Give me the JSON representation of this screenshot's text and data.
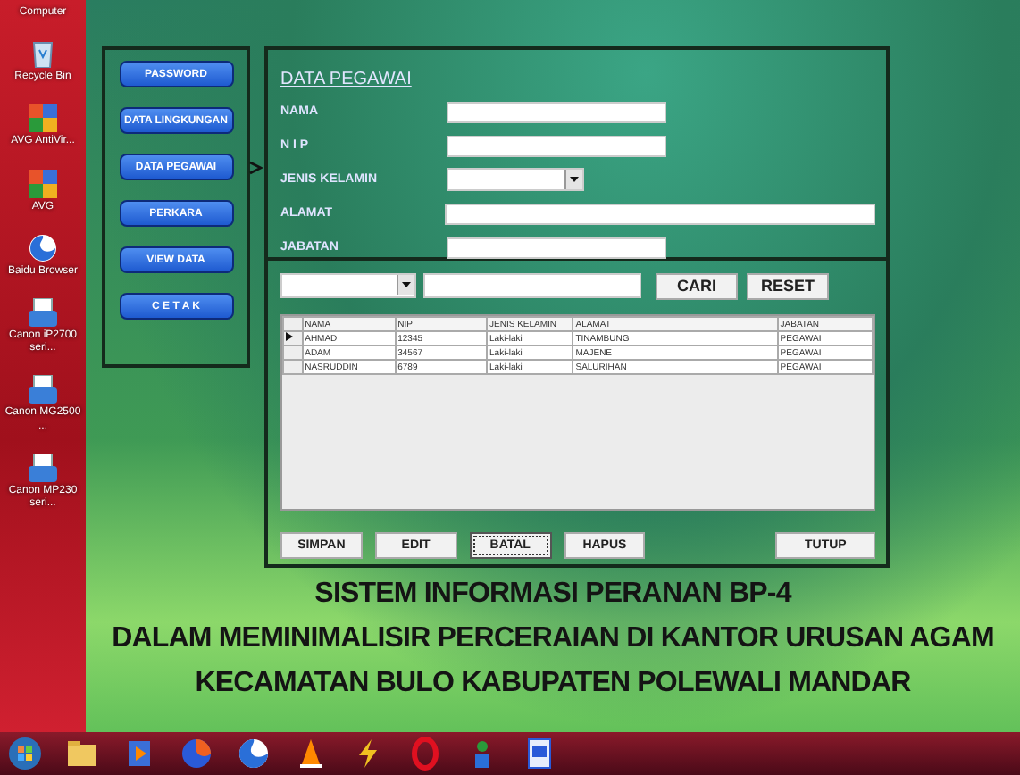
{
  "desktop_icons": [
    {
      "label": "Computer",
      "kind": "none"
    },
    {
      "label": "Recycle Bin",
      "kind": "bin"
    },
    {
      "label": "AVG AntiVir...",
      "kind": "shortcut"
    },
    {
      "label": "AVG",
      "kind": "shortcut"
    },
    {
      "label": "Baidu Browser",
      "kind": "browser"
    },
    {
      "label": "Canon iP2700 seri...",
      "kind": "printer"
    },
    {
      "label": "Canon MG2500 ...",
      "kind": "printer"
    },
    {
      "label": "Canon MP230 seri...",
      "kind": "printer"
    }
  ],
  "sidebar": {
    "items": [
      {
        "label": "PASSWORD",
        "selected": false
      },
      {
        "label": "DATA LINGKUNGAN",
        "selected": false
      },
      {
        "label": "DATA PEGAWAI",
        "selected": true
      },
      {
        "label": "PERKARA",
        "selected": false
      },
      {
        "label": "VIEW DATA",
        "selected": false
      },
      {
        "label": "C E T A K",
        "selected": false
      }
    ]
  },
  "form": {
    "title": "DATA PEGAWAI",
    "fields": [
      {
        "label": "NAMA",
        "kind": "text"
      },
      {
        "label": "N I P",
        "kind": "text"
      },
      {
        "label": "JENIS KELAMIN",
        "kind": "dropdown"
      },
      {
        "label": "ALAMAT",
        "kind": "longtext"
      },
      {
        "label": "JABATAN",
        "kind": "text"
      }
    ]
  },
  "search": {
    "buttons": [
      "CARI",
      "RESET"
    ]
  },
  "table": {
    "columns": [
      "NAMA",
      "NIP",
      "JENIS KELAMIN",
      "ALAMAT",
      "JABATAN"
    ],
    "rows": [
      {
        "selected": true,
        "cells": [
          "AHMAD",
          "12345",
          "Laki-laki",
          "TINAMBUNG",
          "PEGAWAI"
        ]
      },
      {
        "selected": false,
        "cells": [
          "ADAM",
          "34567",
          "Laki-laki",
          "MAJENE",
          "PEGAWAI"
        ]
      },
      {
        "selected": false,
        "cells": [
          "NASRUDDIN",
          "6789",
          "Laki-laki",
          "SALURIHAN",
          "PEGAWAI"
        ]
      }
    ]
  },
  "actions": [
    {
      "label": "SIMPAN",
      "focused": false
    },
    {
      "label": "EDIT",
      "focused": false
    },
    {
      "label": "BATAL",
      "focused": true
    },
    {
      "label": "HAPUS",
      "focused": false
    },
    {
      "label": "TUTUP",
      "focused": false
    }
  ],
  "titles": [
    "SISTEM INFORMASI PERANAN BP-4",
    "DALAM MEMINIMALISIR PERCERAIAN DI KANTOR URUSAN AGAM",
    "KECAMATAN BULO KABUPATEN POLEWALI MANDAR"
  ]
}
